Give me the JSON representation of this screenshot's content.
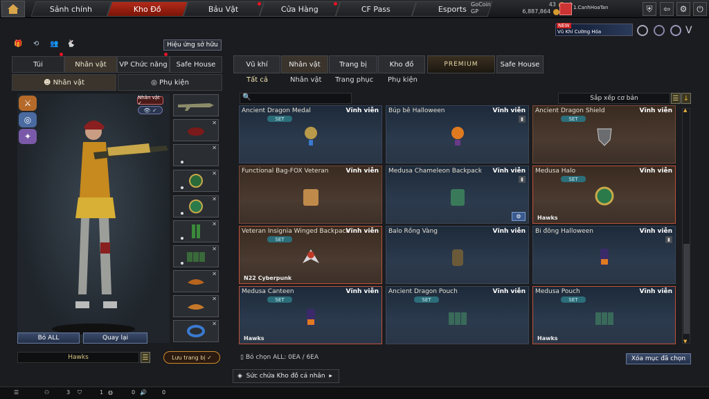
{
  "nav": {
    "tabs": [
      "Sảnh chính",
      "Kho Đồ",
      "Bảu Vật",
      "Cửa Hàng",
      "CF Pass",
      "Esports"
    ],
    "active": 1
  },
  "currency": {
    "gocoin_label": "GoCoin",
    "gocoin_value": "43",
    "gp_label": "GP",
    "gp_value": "6,887,864"
  },
  "user": {
    "name": "1.CanhHoaTan"
  },
  "promo": {
    "badge": "NEW",
    "text": "Vũ Khí Cường Hóa"
  },
  "left": {
    "effect_button": "Hiệu ứng sở hữu",
    "tabs": [
      "Túi",
      "Nhân vật",
      "VP Chức năng",
      "Safe House"
    ],
    "subtabs": [
      "Nhân vật",
      "Phụ kiện"
    ],
    "char_badge": "Nhân vật ✓",
    "buttons": {
      "remove_all": "Bỏ ALL",
      "back": "Quay lại"
    },
    "preset_name": "Hawks",
    "save_button": "Lưu trang bị"
  },
  "right": {
    "tabs": [
      "Vũ khí",
      "Nhân vật",
      "Trang bị",
      "Kho đồ",
      "PREMIUM",
      "Safe House"
    ],
    "subtabs": [
      "Tất cả",
      "Nhân vật",
      "Trang phục",
      "Phụ kiện"
    ],
    "sort_label": "Sắp xếp cơ bản",
    "selected_text": "Bỏ chọn ALL: 0EA / 6EA",
    "clear_button": "Xóa mục đã chọn",
    "repair_button": "Sức chứa Kho đồ cá nhân"
  },
  "items": [
    {
      "name": "Ancient Dragon Medal",
      "duration": "Vĩnh viễn",
      "set": "SET",
      "tag": "",
      "style": "blue",
      "icon": "medal-icon"
    },
    {
      "name": "Búp bê Halloween",
      "duration": "Vĩnh viễn",
      "set": "",
      "tag": "",
      "style": "blue",
      "icon": "doll-icon",
      "trash": true
    },
    {
      "name": "Ancient Dragon Shield",
      "duration": "Vĩnh viễn",
      "set": "SET",
      "tag": "",
      "style": "brown",
      "icon": "shield-icon"
    },
    {
      "name": "Functional Bag-FOX Veteran",
      "duration": "Vĩnh viễn",
      "set": "",
      "tag": "",
      "style": "brown",
      "icon": "bag-icon"
    },
    {
      "name": "Medusa Chameleon Backpack",
      "duration": "Vĩnh viễn",
      "set": "",
      "tag": "",
      "style": "blue",
      "icon": "backpack-icon",
      "trash": true,
      "gear": true
    },
    {
      "name": "Medusa Halo",
      "duration": "Vĩnh viễn",
      "set": "SET",
      "tag": "Hawks",
      "style": "brown red",
      "icon": "halo-icon"
    },
    {
      "name": "Veteran Insignia Winged Backpack",
      "duration": "Vĩnh viễn",
      "set": "SET",
      "tag": "N22 Cyberpunk",
      "style": "brown red",
      "icon": "wing-icon"
    },
    {
      "name": "Balo Rồng Vàng",
      "duration": "Vĩnh viễn",
      "set": "",
      "tag": "",
      "style": "blue",
      "icon": "balo-icon"
    },
    {
      "name": "Bi đông Halloween",
      "duration": "Vĩnh viễn",
      "set": "",
      "tag": "",
      "style": "blue",
      "icon": "canteen-icon",
      "trash": true
    },
    {
      "name": "Medusa Canteen",
      "duration": "Vĩnh viễn",
      "set": "SET",
      "tag": "Hawks",
      "style": "blue red",
      "icon": "canteen-icon"
    },
    {
      "name": "Ancient Dragon Pouch",
      "duration": "Vĩnh viễn",
      "set": "SET",
      "tag": "",
      "style": "blue",
      "icon": "pouch-icon"
    },
    {
      "name": "Medusa Pouch",
      "duration": "Vĩnh viễn",
      "set": "SET",
      "tag": "Hawks",
      "style": "blue red",
      "icon": "pouch-icon"
    }
  ],
  "bottom": {
    "count1": "3",
    "count2": "1",
    "count3": "0",
    "count4": "0"
  }
}
